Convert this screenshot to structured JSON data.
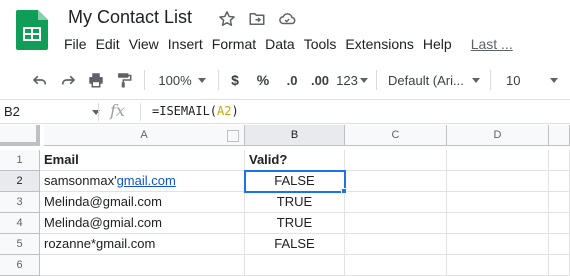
{
  "app": {
    "title": "My Contact List",
    "brand_color": "#0f9d58"
  },
  "menu": {
    "items": [
      "File",
      "Edit",
      "View",
      "Insert",
      "Format",
      "Data",
      "Tools",
      "Extensions",
      "Help"
    ],
    "last_edit": "Last ..."
  },
  "toolbar": {
    "zoom": "100%",
    "currency": "$",
    "percent": "%",
    "decrease_decimal": ".0",
    "increase_decimal": ".00",
    "more_formats": "123",
    "font": "Default (Ari...",
    "font_size": "10"
  },
  "formula_bar": {
    "name_box": "B2",
    "fx": "fx",
    "formula_prefix": "=ISEMAIL(",
    "formula_ref": "A2",
    "formula_suffix": ")"
  },
  "grid": {
    "columns": [
      "A",
      "B",
      "C",
      "D"
    ],
    "rows": [
      "1",
      "2",
      "3",
      "4",
      "5",
      "6"
    ],
    "header": {
      "a": "Email",
      "b": "Valid?"
    },
    "data": [
      {
        "a_prefix": "samsonmax'",
        "a_link": "gmail.com",
        "b": "FALSE"
      },
      {
        "a": "Melinda@gmail.com",
        "b": "TRUE"
      },
      {
        "a": "Melinda@gmial.com",
        "b": "TRUE"
      },
      {
        "a": "rozanne*gmail.com",
        "b": "FALSE"
      }
    ],
    "selected_cell": "B2",
    "selection_color": "#1a73e8",
    "link_color": "#1155cc"
  }
}
